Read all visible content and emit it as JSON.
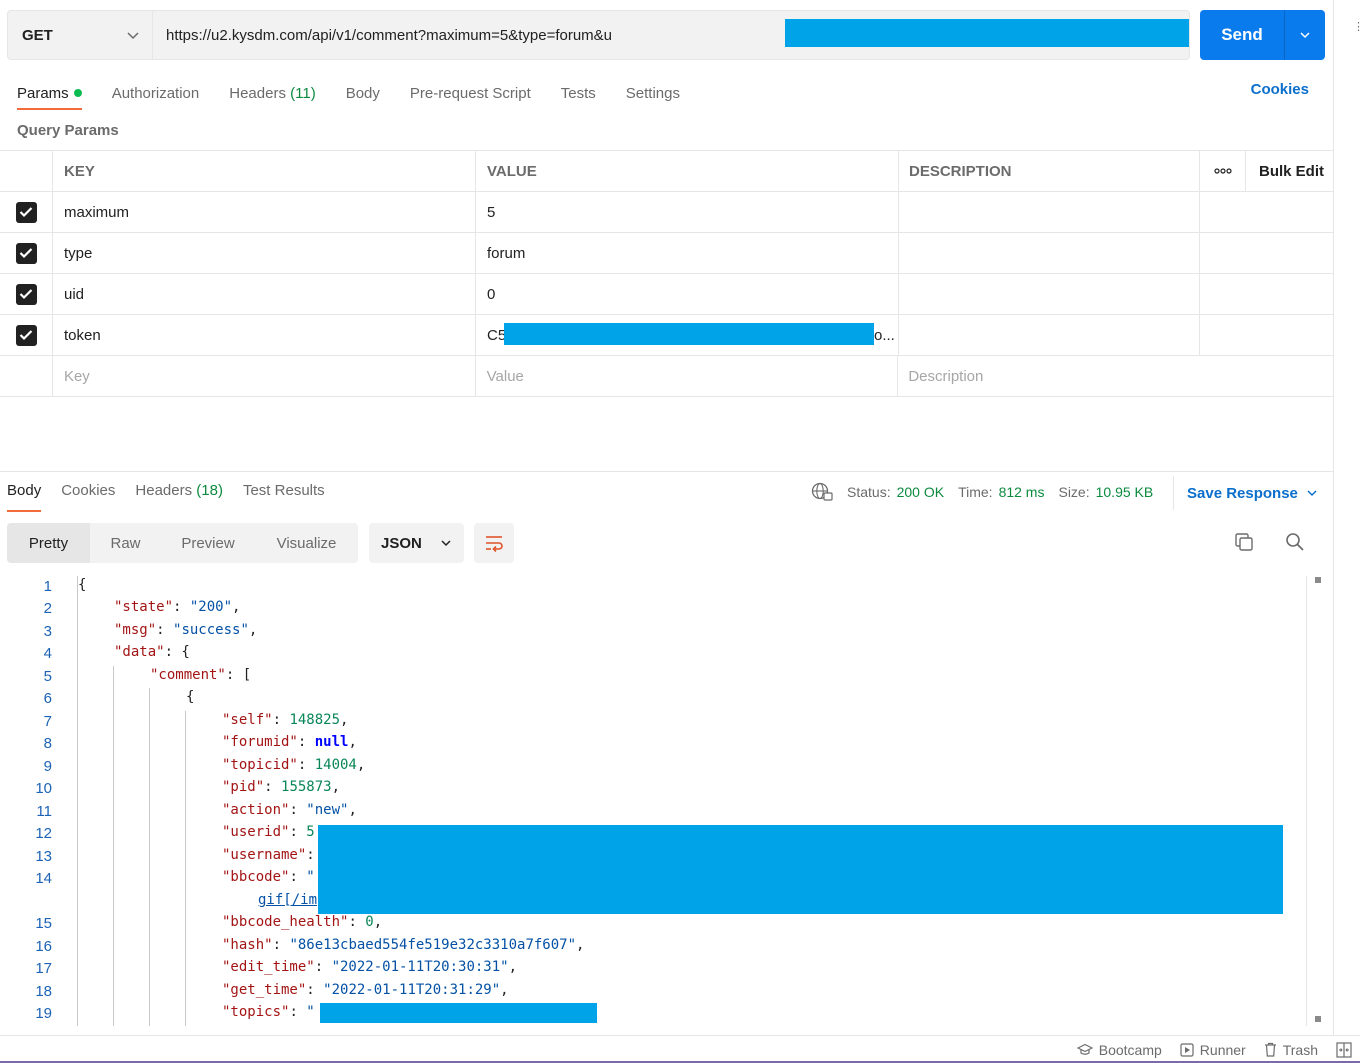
{
  "request": {
    "method": "GET",
    "url": "https://u2.kysdm.com/api/v1/comment?maximum=5&type=forum&u",
    "send_label": "Send"
  },
  "request_tabs": {
    "params": "Params",
    "authorization": "Authorization",
    "headers": "Headers",
    "headers_count": "(11)",
    "body": "Body",
    "pre_request": "Pre-request Script",
    "tests": "Tests",
    "settings": "Settings",
    "cookies": "Cookies"
  },
  "query_params": {
    "title": "Query Params",
    "headers": {
      "key": "KEY",
      "value": "VALUE",
      "description": "DESCRIPTION",
      "bulk_edit": "Bulk Edit"
    },
    "rows": [
      {
        "key": "maximum",
        "value": "5",
        "checked": true
      },
      {
        "key": "type",
        "value": "forum",
        "checked": true
      },
      {
        "key": "uid",
        "value": "0",
        "checked": true
      },
      {
        "key": "token",
        "value": "C5",
        "value_tail": "o...",
        "checked": true
      }
    ],
    "placeholders": {
      "key": "Key",
      "value": "Value",
      "description": "Description"
    }
  },
  "response_tabs": {
    "body": "Body",
    "cookies": "Cookies",
    "headers": "Headers",
    "headers_count": "(18)",
    "test_results": "Test Results"
  },
  "response_status": {
    "status_label": "Status:",
    "status_value": "200 OK",
    "time_label": "Time:",
    "time_value": "812 ms",
    "size_label": "Size:",
    "size_value": "10.95 KB",
    "save_response": "Save Response"
  },
  "view_modes": [
    "Pretty",
    "Raw",
    "Preview",
    "Visualize"
  ],
  "format": "JSON",
  "code_lines": [
    {
      "n": "1",
      "ind": 0,
      "t": [
        [
          "p",
          "{"
        ]
      ]
    },
    {
      "n": "2",
      "ind": 1,
      "t": [
        [
          "k",
          "\"state\""
        ],
        [
          "p",
          ": "
        ],
        [
          "s",
          "\"200\""
        ],
        [
          "p",
          ","
        ]
      ]
    },
    {
      "n": "3",
      "ind": 1,
      "t": [
        [
          "k",
          "\"msg\""
        ],
        [
          "p",
          ": "
        ],
        [
          "s",
          "\"success\""
        ],
        [
          "p",
          ","
        ]
      ]
    },
    {
      "n": "4",
      "ind": 1,
      "t": [
        [
          "k",
          "\"data\""
        ],
        [
          "p",
          ": {"
        ]
      ]
    },
    {
      "n": "5",
      "ind": 2,
      "t": [
        [
          "k",
          "\"comment\""
        ],
        [
          "p",
          ": ["
        ]
      ]
    },
    {
      "n": "6",
      "ind": 3,
      "t": [
        [
          "p",
          "{"
        ]
      ]
    },
    {
      "n": "7",
      "ind": 4,
      "t": [
        [
          "k",
          "\"self\""
        ],
        [
          "p",
          ": "
        ],
        [
          "n",
          "148825"
        ],
        [
          "p",
          ","
        ]
      ]
    },
    {
      "n": "8",
      "ind": 4,
      "t": [
        [
          "k",
          "\"forumid\""
        ],
        [
          "p",
          ": "
        ],
        [
          "kw",
          "null"
        ],
        [
          "p",
          ","
        ]
      ]
    },
    {
      "n": "9",
      "ind": 4,
      "t": [
        [
          "k",
          "\"topicid\""
        ],
        [
          "p",
          ": "
        ],
        [
          "n",
          "14004"
        ],
        [
          "p",
          ","
        ]
      ]
    },
    {
      "n": "10",
      "ind": 4,
      "t": [
        [
          "k",
          "\"pid\""
        ],
        [
          "p",
          ": "
        ],
        [
          "n",
          "155873"
        ],
        [
          "p",
          ","
        ]
      ]
    },
    {
      "n": "11",
      "ind": 4,
      "t": [
        [
          "k",
          "\"action\""
        ],
        [
          "p",
          ": "
        ],
        [
          "s",
          "\"new\""
        ],
        [
          "p",
          ","
        ]
      ]
    },
    {
      "n": "12",
      "ind": 4,
      "t": [
        [
          "k",
          "\"userid\""
        ],
        [
          "p",
          ": "
        ],
        [
          "n",
          "5"
        ]
      ]
    },
    {
      "n": "13",
      "ind": 4,
      "t": [
        [
          "k",
          "\"username\""
        ],
        [
          "p",
          ":"
        ]
      ]
    },
    {
      "n": "14",
      "ind": 4,
      "t": [
        [
          "k",
          "\"bbcode\""
        ],
        [
          "p",
          ": "
        ],
        [
          "s",
          "\""
        ]
      ]
    },
    {
      "n": "",
      "ind": 5,
      "t": [
        [
          "link",
          "gif[/im"
        ]
      ]
    },
    {
      "n": "15",
      "ind": 4,
      "t": [
        [
          "k",
          "\"bbcode_health\""
        ],
        [
          "p",
          ": "
        ],
        [
          "n",
          "0"
        ],
        [
          "p",
          ","
        ]
      ]
    },
    {
      "n": "16",
      "ind": 4,
      "t": [
        [
          "k",
          "\"hash\""
        ],
        [
          "p",
          ": "
        ],
        [
          "s",
          "\"86e13cbaed554fe519e32c3310a7f607\""
        ],
        [
          "p",
          ","
        ]
      ]
    },
    {
      "n": "17",
      "ind": 4,
      "t": [
        [
          "k",
          "\"edit_time\""
        ],
        [
          "p",
          ": "
        ],
        [
          "s",
          "\"2022-01-11T20:30:31\""
        ],
        [
          "p",
          ","
        ]
      ]
    },
    {
      "n": "18",
      "ind": 4,
      "t": [
        [
          "k",
          "\"get_time\""
        ],
        [
          "p",
          ": "
        ],
        [
          "s",
          "\"2022-01-11T20:31:29\""
        ],
        [
          "p",
          ","
        ]
      ]
    },
    {
      "n": "19",
      "ind": 4,
      "t": [
        [
          "k",
          "\"topics\""
        ],
        [
          "p",
          ": "
        ],
        [
          "s",
          "\""
        ]
      ]
    }
  ],
  "footer": {
    "bootcamp": "Bootcamp",
    "runner": "Runner",
    "trash": "Trash"
  },
  "colors": {
    "accent": "#097bed",
    "tab_underline": "#f26b3a",
    "status_green": "#0c8b3f",
    "redaction": "#00a2e8"
  }
}
